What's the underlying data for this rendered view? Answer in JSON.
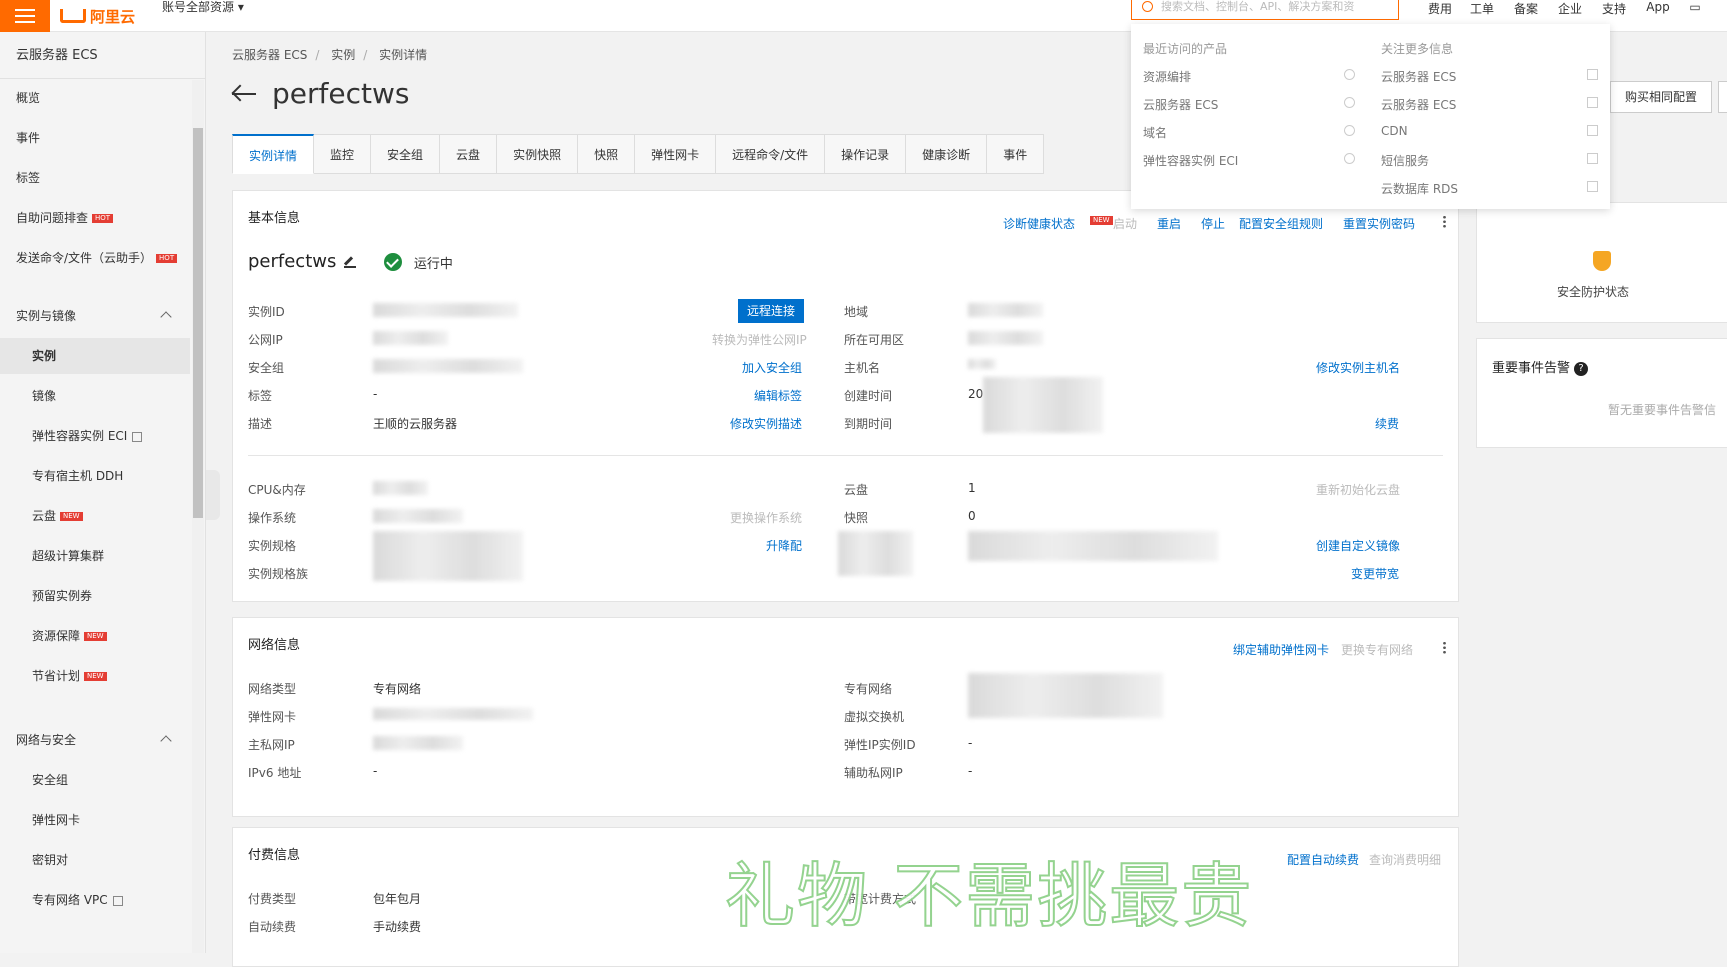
{
  "topbar": {
    "logo_text": "阿里云",
    "account_label": "账号全部资源",
    "search_placeholder": "搜索文档、控制台、API、解决方案和资",
    "nav": [
      "费用",
      "工单",
      "备案",
      "企业",
      "支持",
      "App"
    ]
  },
  "sidebar": {
    "title": "云服务器 ECS",
    "items": [
      {
        "label": "概览",
        "level": 1
      },
      {
        "label": "事件",
        "level": 1
      },
      {
        "label": "标签",
        "level": 1
      },
      {
        "label": "自助问题排查",
        "level": 1,
        "badge": "HOT"
      },
      {
        "label": "发送命令/文件（云助手）",
        "level": 1,
        "badge": "HOT"
      },
      {
        "label": "实例与镜像",
        "level": 1,
        "group": true
      },
      {
        "label": "实例",
        "level": 2,
        "active": true
      },
      {
        "label": "镜像",
        "level": 2
      },
      {
        "label": "弹性容器实例 ECI",
        "level": 2,
        "external": true
      },
      {
        "label": "专有宿主机 DDH",
        "level": 2
      },
      {
        "label": "云盘",
        "level": 2,
        "badge": "NEW"
      },
      {
        "label": "超级计算集群",
        "level": 2
      },
      {
        "label": "预留实例券",
        "level": 2
      },
      {
        "label": "资源保障",
        "level": 2,
        "badge": "NEW"
      },
      {
        "label": "节省计划",
        "level": 2,
        "badge": "NEW"
      },
      {
        "label": "网络与安全",
        "level": 1,
        "group": true
      },
      {
        "label": "安全组",
        "level": 2
      },
      {
        "label": "弹性网卡",
        "level": 2
      },
      {
        "label": "密钥对",
        "level": 2
      },
      {
        "label": "专有网络 VPC",
        "level": 2,
        "external": true
      }
    ]
  },
  "breadcrumb": [
    "云服务器 ECS",
    "实例",
    "实例详情"
  ],
  "page_title": "perfectws",
  "tabs": [
    "实例详情",
    "监控",
    "安全组",
    "云盘",
    "实例快照",
    "快照",
    "弹性网卡",
    "远程命令/文件",
    "操作记录",
    "健康诊断",
    "事件"
  ],
  "basic": {
    "title": "基本信息",
    "actions": {
      "diagnose": "诊断健康状态",
      "diagnose_badge": "NEW",
      "start": "启动",
      "restart": "重启",
      "stop": "停止",
      "sg_rules": "配置安全组规则",
      "reset_pwd": "重置实例密码"
    },
    "instance_name": "perfectws",
    "status": "运行中",
    "labels_left": [
      "实例ID",
      "公网IP",
      "安全组",
      "标签",
      "描述"
    ],
    "tag_value": "-",
    "desc_value": "王顺的云服务器",
    "remote_btn": "远程连接",
    "link_eip": "转换为弹性公网IP",
    "link_add_sg": "加入安全组",
    "link_edit_tag": "编辑标签",
    "link_edit_desc": "修改实例描述",
    "labels_right": [
      "地域",
      "所在可用区",
      "主机名",
      "创建时间",
      "到期时间"
    ],
    "create_time_prefix": "20",
    "link_rename_host": "修改实例主机名",
    "link_renew": "续费",
    "labels_left2": [
      "CPU&内存",
      "操作系统",
      "实例规格",
      "实例规格族"
    ],
    "link_change_os": "更换操作系统",
    "link_upgrade": "升降配",
    "labels_right2": [
      "云盘",
      "快照"
    ],
    "disk_count": "1",
    "snapshot_count": "0",
    "link_reinit_disk": "重新初始化云盘",
    "link_custom_image": "创建自定义镜像",
    "link_bandwidth": "变更带宽"
  },
  "network": {
    "title": "网络信息",
    "action_bind": "绑定辅助弹性网卡",
    "action_change": "更换专有网络",
    "labels_left": [
      "网络类型",
      "弹性网卡",
      "主私网IP",
      "IPv6 地址"
    ],
    "network_type": "专有网络",
    "ipv6": "-",
    "labels_right": [
      "专有网络",
      "虚拟交换机",
      "弹性IP实例ID",
      "辅助私网IP"
    ],
    "eip_id": "-",
    "secondary_ip": "-"
  },
  "billing": {
    "title": "付费信息",
    "action_auto_renew": "配置自动续费",
    "action_query": "查询消费明细",
    "labels_left": [
      "付费类型",
      "自动续费"
    ],
    "pay_type": "包年包月",
    "auto_renew": "手动续费",
    "bandwidth_label_partial": "带宽计费方式"
  },
  "right_panel": {
    "buy_same": "购买相同配置",
    "security_status": "安全防护状态",
    "events_title": "重要事件告警",
    "events_empty": "暂无重要事件告警信"
  },
  "dropdown": {
    "recent_title": "最近访问的产品",
    "recent": [
      "资源编排",
      "云服务器 ECS",
      "域名",
      "弹性容器实例 ECI"
    ],
    "more_title": "关注更多信息",
    "more": [
      "云服务器 ECS",
      "云服务器 ECS",
      "CDN",
      "短信服务",
      "云数据库 RDS"
    ]
  },
  "watermark": "礼物 不需挑最贵"
}
